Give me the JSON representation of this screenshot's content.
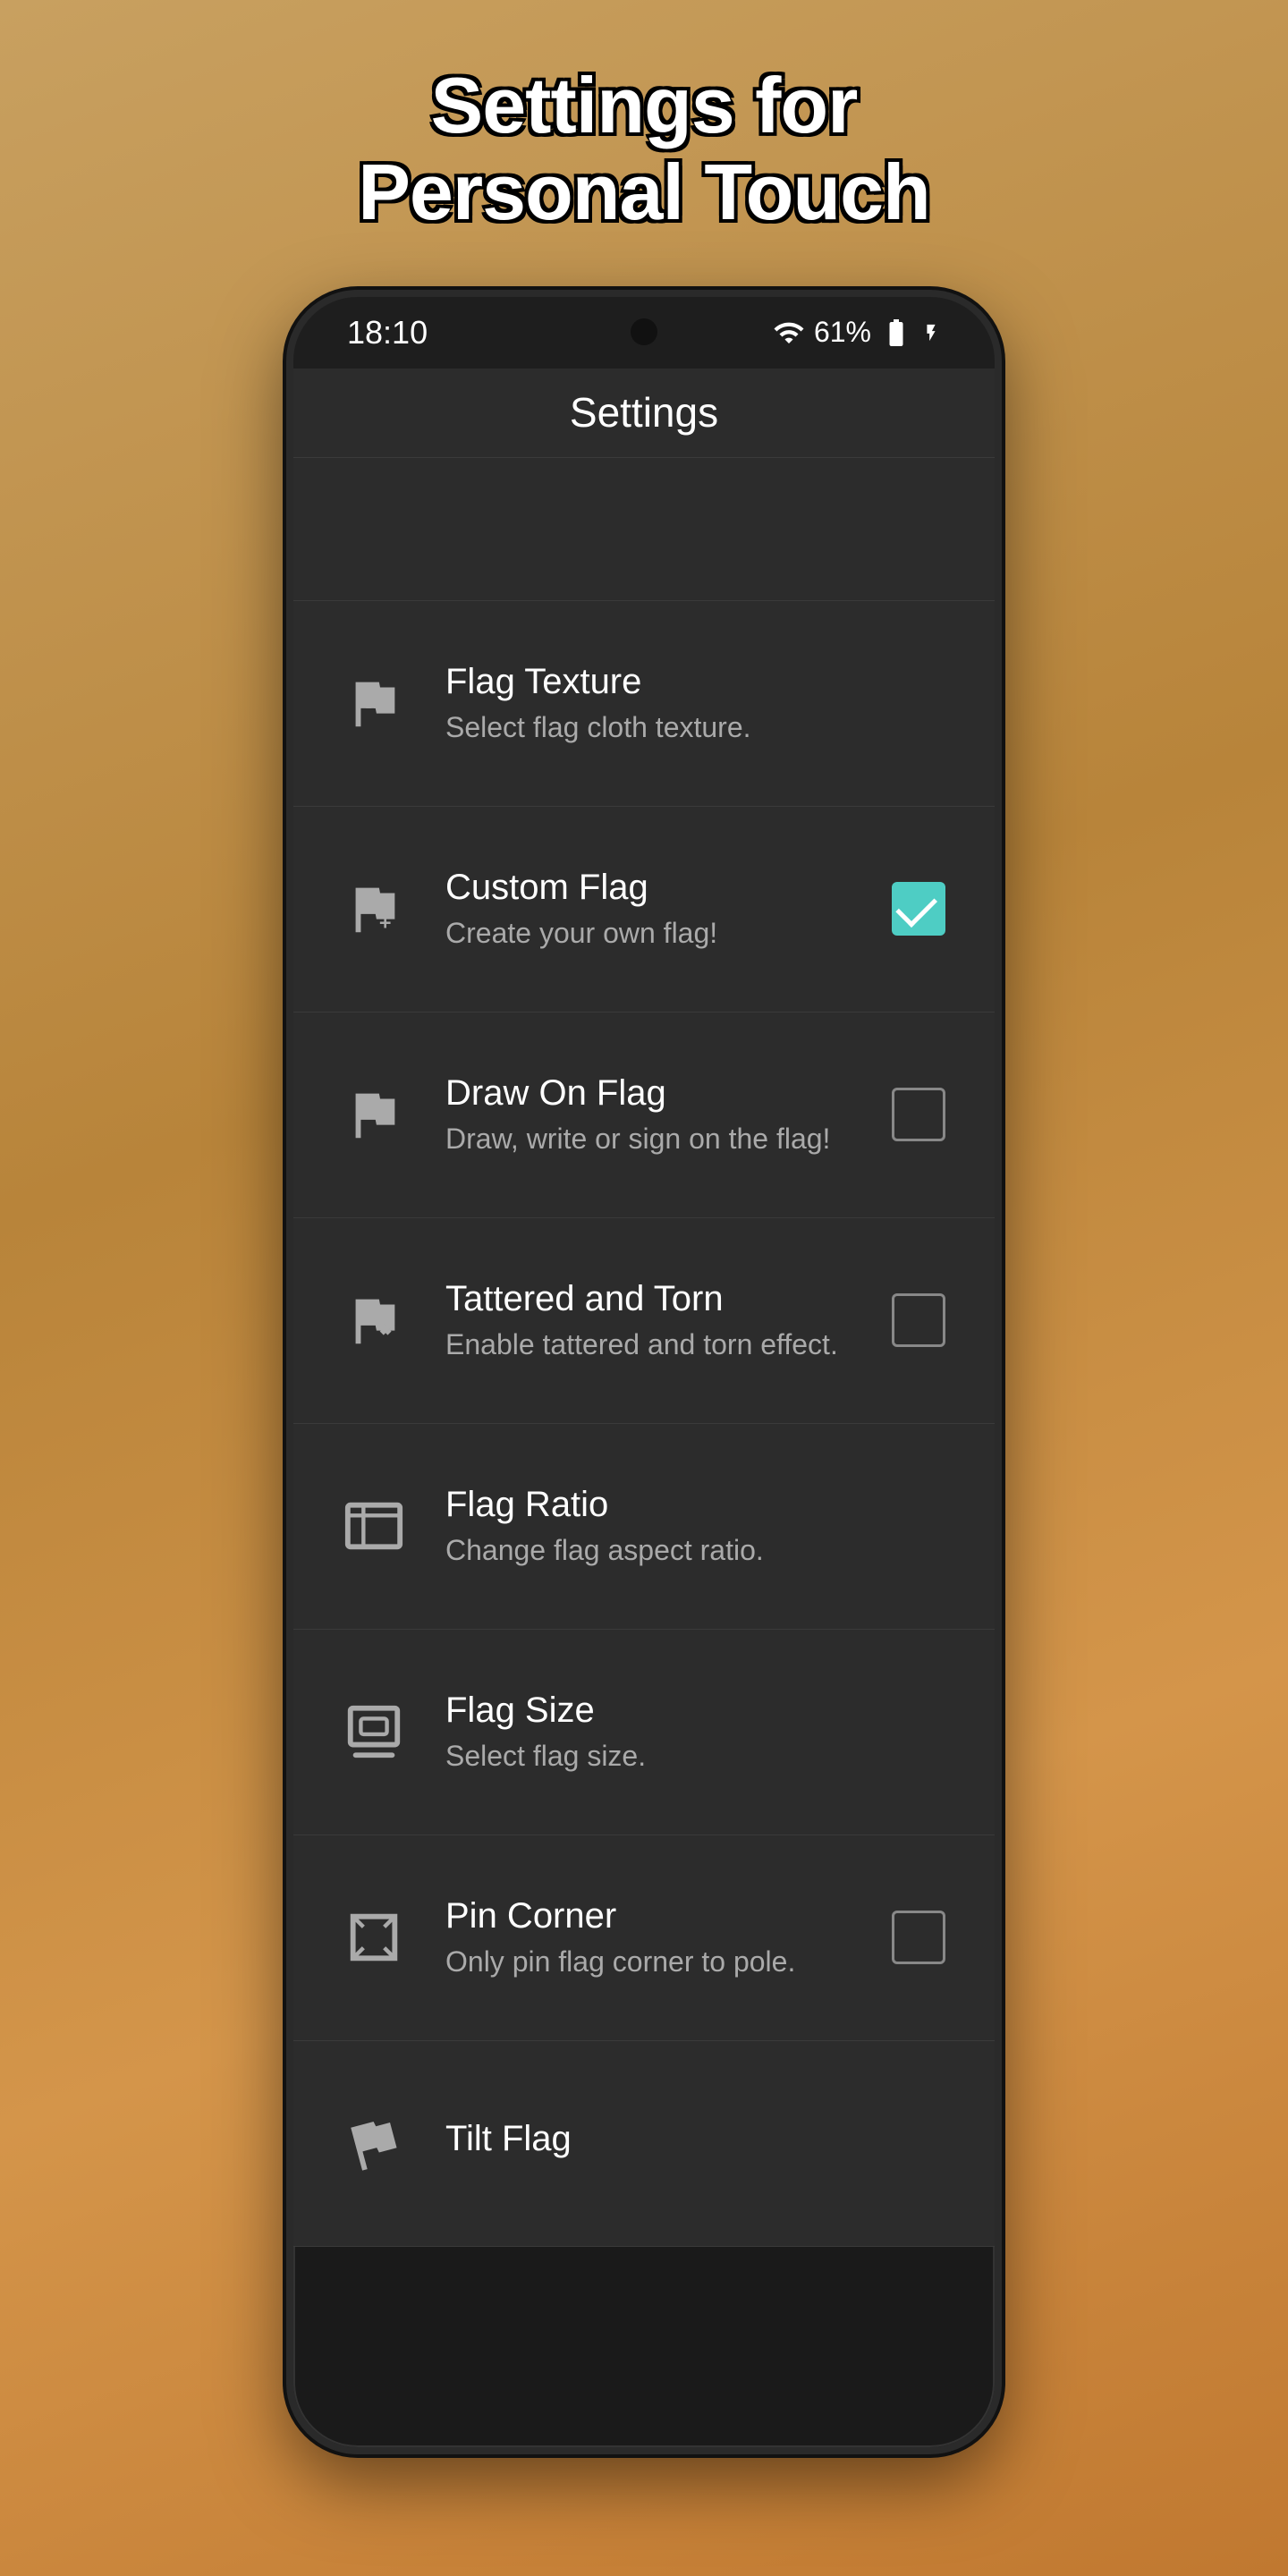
{
  "page": {
    "header_title_line1": "Settings for",
    "header_title_line2": "Personal Touch"
  },
  "status_bar": {
    "time": "18:10",
    "battery_percent": "61%",
    "signal_icon": "signal",
    "battery_icon": "battery"
  },
  "app_bar": {
    "title": "Settings"
  },
  "settings_items": [
    {
      "id": "flag-texture",
      "title": "Flag Texture",
      "subtitle": "Select flag cloth texture.",
      "icon": "flag-texture-icon",
      "control": "none"
    },
    {
      "id": "custom-flag",
      "title": "Custom Flag",
      "subtitle": "Create your own flag!",
      "icon": "custom-flag-icon",
      "control": "checkbox-checked"
    },
    {
      "id": "draw-on-flag",
      "title": "Draw On Flag",
      "subtitle": "Draw, write or sign on the flag!",
      "icon": "draw-flag-icon",
      "control": "checkbox-unchecked"
    },
    {
      "id": "tattered-torn",
      "title": "Tattered and Torn",
      "subtitle": "Enable tattered and torn effect.",
      "icon": "tattered-icon",
      "control": "checkbox-unchecked"
    },
    {
      "id": "flag-ratio",
      "title": "Flag Ratio",
      "subtitle": "Change flag aspect ratio.",
      "icon": "ratio-icon",
      "control": "none"
    },
    {
      "id": "flag-size",
      "title": "Flag Size",
      "subtitle": "Select flag size.",
      "icon": "size-icon",
      "control": "none"
    },
    {
      "id": "pin-corner",
      "title": "Pin Corner",
      "subtitle": "Only pin flag corner to pole.",
      "icon": "pin-icon",
      "control": "checkbox-unchecked"
    },
    {
      "id": "tilt-flag",
      "title": "Tilt Flag",
      "subtitle": "",
      "icon": "tilt-icon",
      "control": "none"
    }
  ]
}
